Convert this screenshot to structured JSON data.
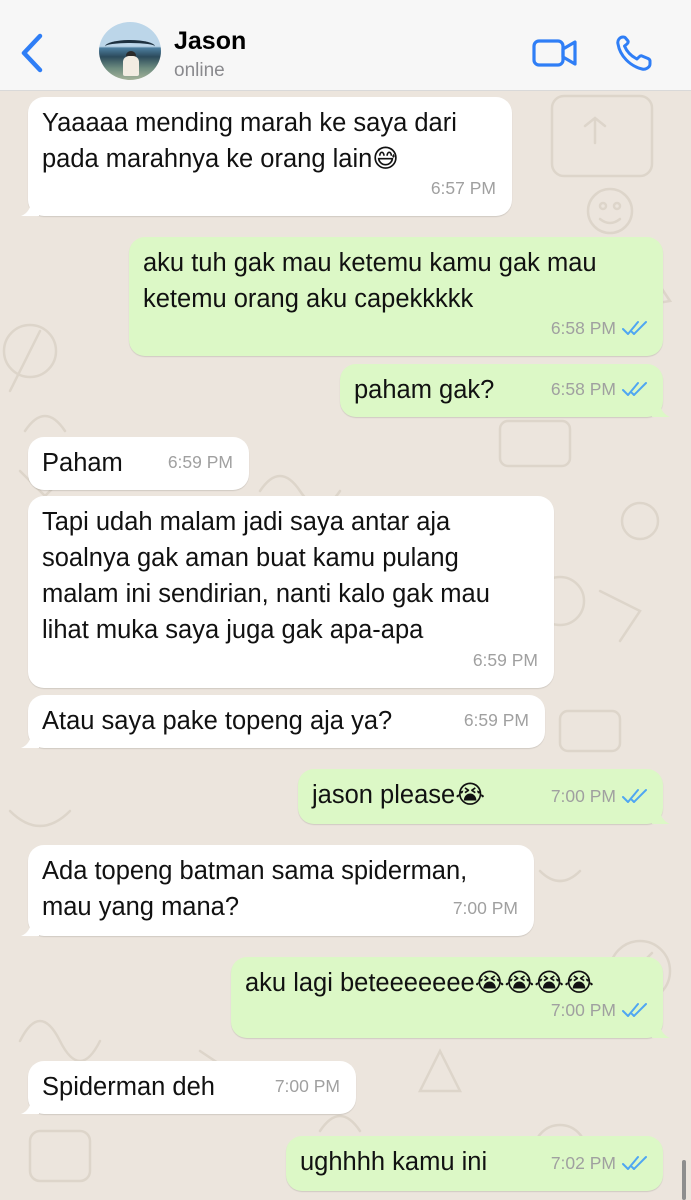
{
  "header": {
    "contact_name": "Jason",
    "status": "online",
    "accent_color": "#2f7ef6"
  },
  "icons": [
    "chevron-left-icon",
    "video-camera-icon",
    "phone-icon",
    "double-check-icon"
  ],
  "messages": [
    {
      "dir": "in",
      "text": "Yaaaaa mending marah ke saya dari\npada marahnya ke orang lain😅",
      "time": "6:57 PM"
    },
    {
      "dir": "out",
      "text": "aku tuh gak mau ketemu kamu gak mau\nketemu orang aku capekkkkk",
      "time": "6:58 PM",
      "status": "read"
    },
    {
      "dir": "out",
      "text": "paham gak?",
      "time": "6:58 PM",
      "status": "read"
    },
    {
      "dir": "in",
      "text": "Paham",
      "time": "6:59 PM"
    },
    {
      "dir": "in",
      "text": "Tapi udah malam jadi saya antar aja\nsoalnya gak aman buat kamu pulang\nmalam ini sendirian, nanti kalo gak mau\nlihat muka saya juga gak apa-apa",
      "time": "6:59 PM"
    },
    {
      "dir": "in",
      "text": "Atau saya pake topeng aja ya?",
      "time": "6:59 PM"
    },
    {
      "dir": "out",
      "text": "jason please😭",
      "time": "7:00 PM",
      "status": "read"
    },
    {
      "dir": "in",
      "text": "Ada topeng batman sama spiderman,\nmau yang mana?",
      "time": "7:00 PM"
    },
    {
      "dir": "out",
      "text": "aku lagi beteeeeeee😭😭😭😭",
      "time": "7:00 PM",
      "status": "read"
    },
    {
      "dir": "in",
      "text": "Spiderman deh",
      "time": "7:00 PM"
    },
    {
      "dir": "out",
      "text": "ughhhh kamu ini",
      "time": "7:02 PM",
      "status": "read"
    }
  ]
}
